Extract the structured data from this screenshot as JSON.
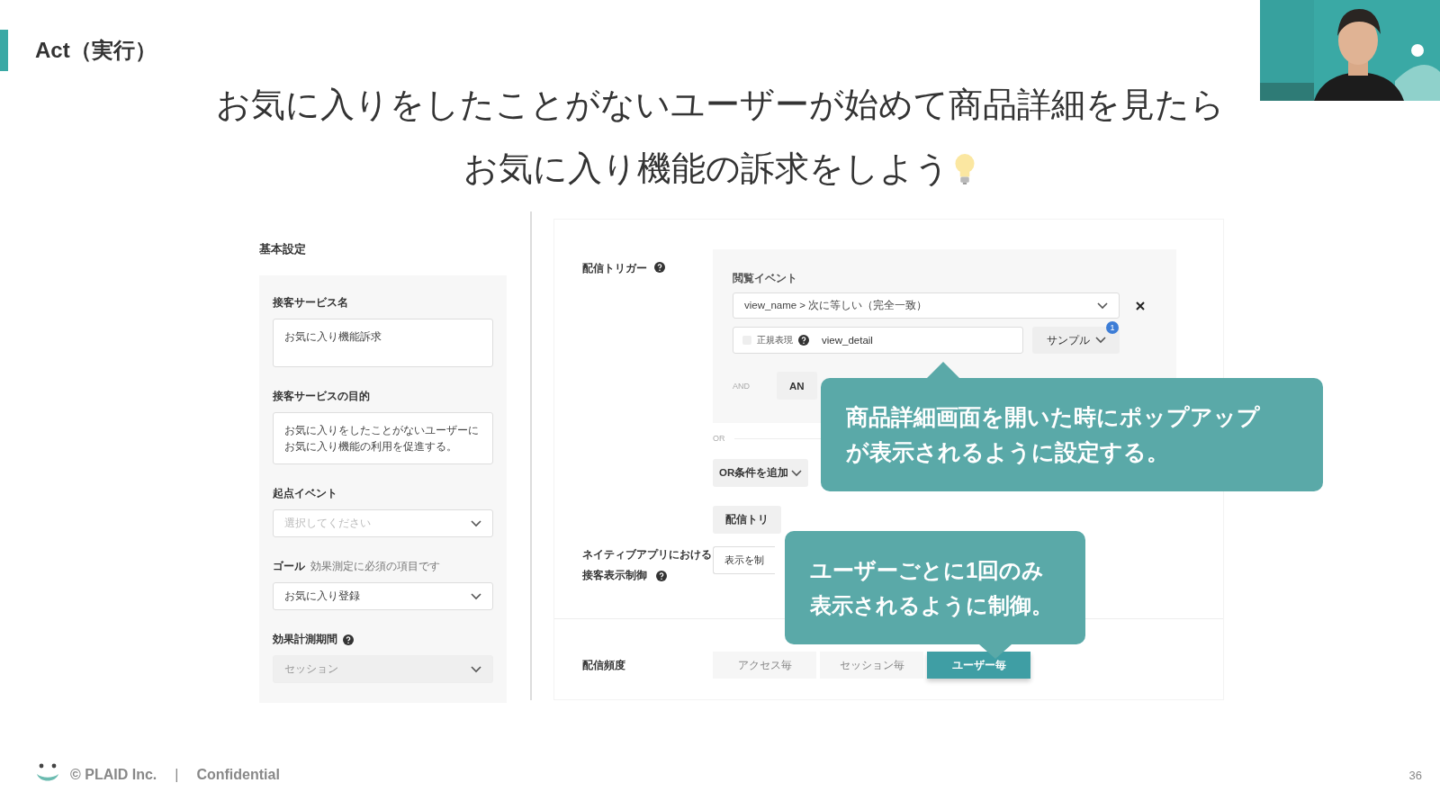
{
  "slide": {
    "section_title": "Act（実行）",
    "headline": [
      "お気に入りをしたことがないユーザーが始めて商品詳細を見たら",
      "お気に入り機能の訴求をしよう"
    ]
  },
  "basic_settings": {
    "title": "基本設定",
    "fields": [
      {
        "kind": "textarea",
        "label": "接客サービス名",
        "lines": [
          "お気に入り機能訴求"
        ]
      },
      {
        "kind": "textarea",
        "label": "接客サービスの目的",
        "lines": [
          "お気に入りをしたことがないユーザーに",
          "お気に入り機能の利用を促進する。"
        ]
      },
      {
        "kind": "select",
        "label": "起点イベント",
        "placeholder": "選択してください"
      },
      {
        "kind": "select",
        "label": "ゴール",
        "note": "効果測定に必須の項目です",
        "value": "お気に入り登録"
      },
      {
        "kind": "select",
        "label": "効果計測期間",
        "help": true,
        "value": "セッション",
        "disabled": true
      }
    ]
  },
  "trigger": {
    "label": "配信トリガー",
    "event_label": "閲覧イベント",
    "condition": "view_name > 次に等しい（完全一致）",
    "regex": {
      "label": "正規表現",
      "checked": false
    },
    "value": "view_detail",
    "sample_button": "サンプル",
    "sample_badge": "1",
    "and_label": "AND",
    "and_button": "AN",
    "or_label": "OR",
    "or_button": "OR条件を追加",
    "add_button": "配信トリ"
  },
  "native_control": {
    "label": [
      "ネイティブアプリにおける",
      "接客表示制御"
    ],
    "field": "表示を制"
  },
  "frequency": {
    "label": "配信頻度",
    "options": [
      {
        "label": "アクセス毎",
        "selected": false
      },
      {
        "label": "セッション毎",
        "selected": false
      },
      {
        "label": "ユーザー毎",
        "selected": true
      }
    ]
  },
  "callouts": [
    {
      "lines": [
        "商品詳細画面を開いた時にポップアップ",
        "が表示されるように設定する。"
      ]
    },
    {
      "lines": [
        "ユーザーごとに1回のみ",
        "表示されるように制御。"
      ]
    }
  ],
  "footer": {
    "copyright": "© PLAID Inc.",
    "separator": "|",
    "confidential": "Confidential",
    "page": "36"
  }
}
